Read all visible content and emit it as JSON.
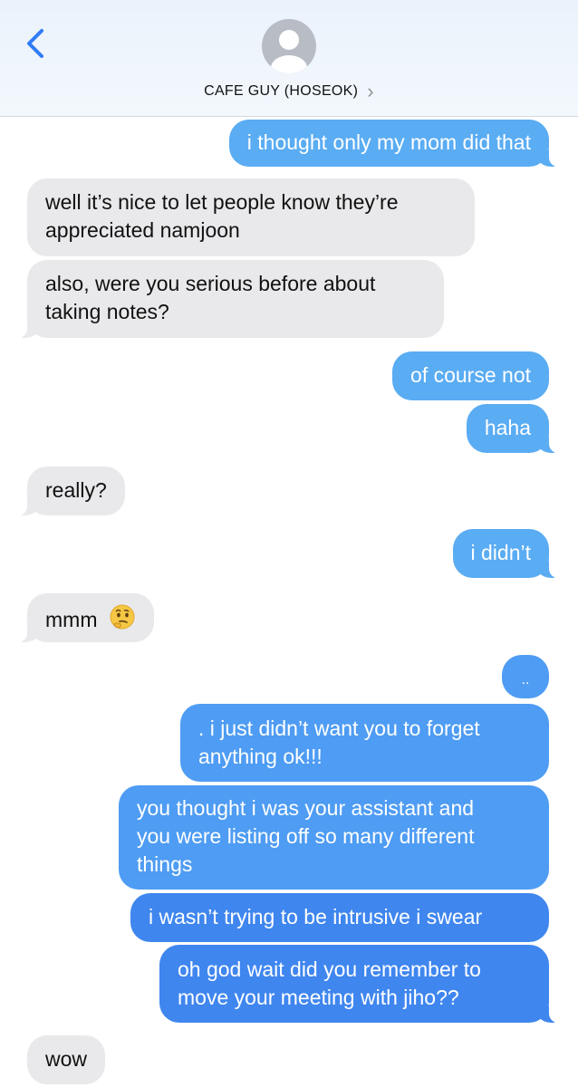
{
  "header": {
    "contact_name": "CAFE GUY (HOSEOK)",
    "chevron": "›",
    "back_icon": "chevron-left-icon",
    "avatar_icon": "person-silhouette-icon",
    "accent_color": "#2f7cf6"
  },
  "messages": [
    {
      "from": "me",
      "text": "i thought only my mom did that"
    },
    {
      "from": "them",
      "lines": [
        "well it’s nice to let people know they’re",
        "appreciated namjoon"
      ]
    },
    {
      "from": "them",
      "lines": [
        "also, were you serious before about",
        "taking notes?"
      ]
    },
    {
      "from": "me",
      "text": "of course not"
    },
    {
      "from": "me",
      "text": "haha"
    },
    {
      "from": "them",
      "text": "really?"
    },
    {
      "from": "me",
      "text": "i didn’t"
    },
    {
      "from": "them",
      "text": "mmm",
      "emoji": "thinking-face-emoji"
    },
    {
      "from": "me",
      "text": ".."
    },
    {
      "from": "me",
      "lines": [
        ". i just didn’t want you to forget",
        "anything ok!!!"
      ]
    },
    {
      "from": "me",
      "lines": [
        "you thought i was your assistant and",
        "you were listing off so many different",
        "things"
      ]
    },
    {
      "from": "me",
      "text": "i wasn’t trying to be intrusive i swear"
    },
    {
      "from": "me",
      "lines": [
        "oh god wait did you remember to",
        "move your meeting with jiho??"
      ]
    },
    {
      "from": "them",
      "text": "wow"
    }
  ],
  "colors": {
    "incoming_bubble": "#e9e9eb",
    "outgoing_light": "#5aacf3",
    "outgoing_mid": "#4e9cf3",
    "outgoing_dark": "#3f86ef"
  }
}
